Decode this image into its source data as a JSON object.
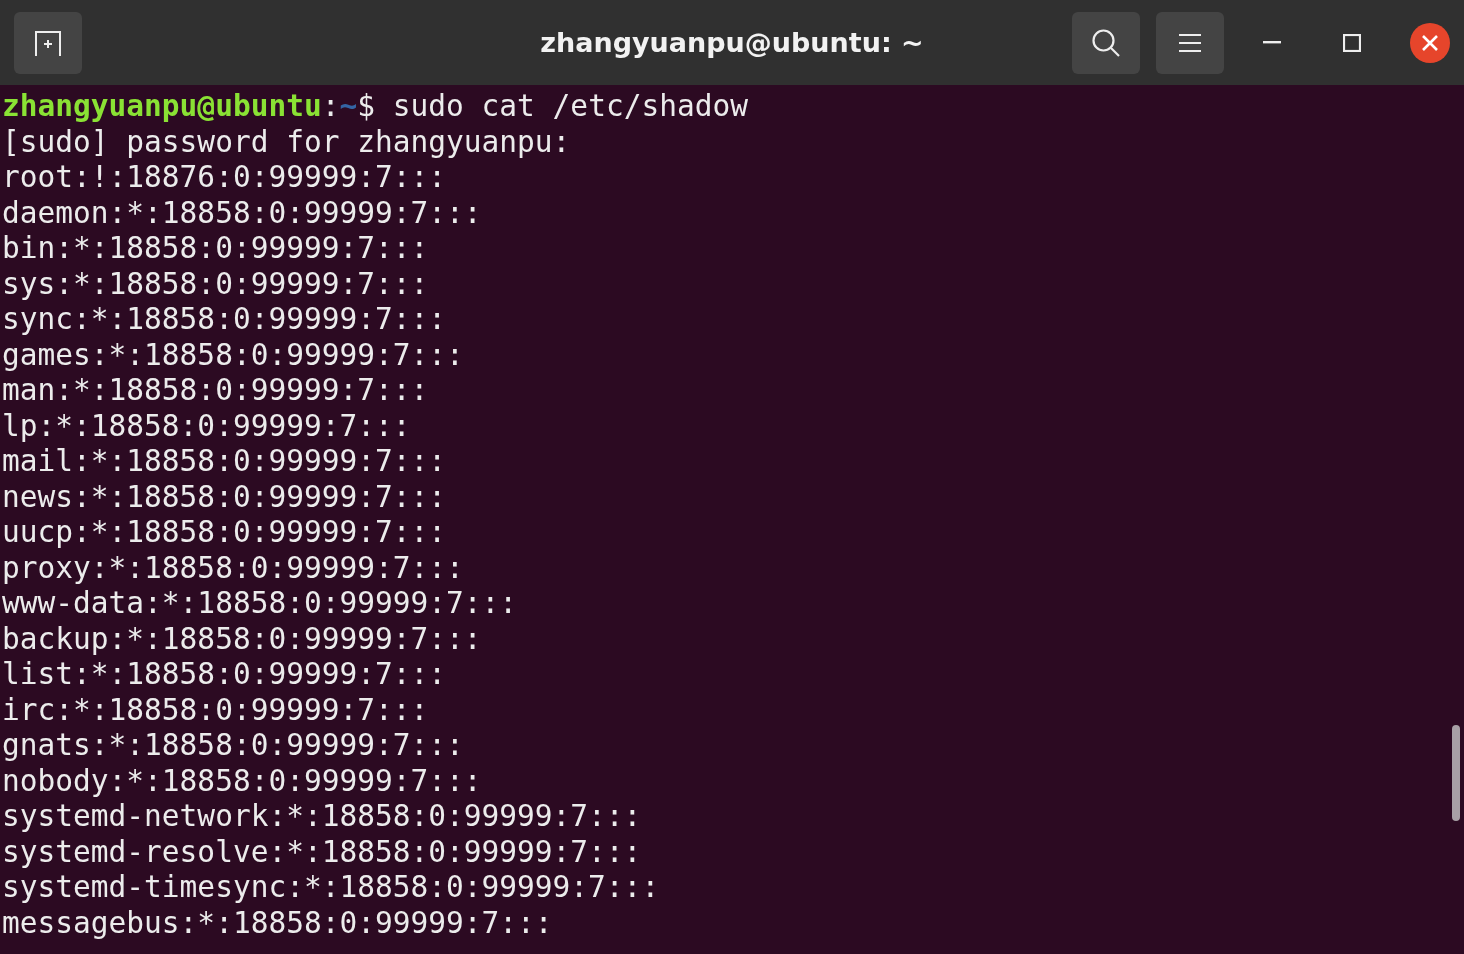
{
  "window": {
    "title": "zhangyuanpu@ubuntu: ~"
  },
  "terminal": {
    "prompt": {
      "user_host": "zhangyuanpu@ubuntu",
      "separator": ":",
      "path": "~",
      "symbol": "$",
      "command": " sudo cat /etc/shadow"
    },
    "output": [
      "[sudo] password for zhangyuanpu:",
      "root:!:18876:0:99999:7:::",
      "daemon:*:18858:0:99999:7:::",
      "bin:*:18858:0:99999:7:::",
      "sys:*:18858:0:99999:7:::",
      "sync:*:18858:0:99999:7:::",
      "games:*:18858:0:99999:7:::",
      "man:*:18858:0:99999:7:::",
      "lp:*:18858:0:99999:7:::",
      "mail:*:18858:0:99999:7:::",
      "news:*:18858:0:99999:7:::",
      "uucp:*:18858:0:99999:7:::",
      "proxy:*:18858:0:99999:7:::",
      "www-data:*:18858:0:99999:7:::",
      "backup:*:18858:0:99999:7:::",
      "list:*:18858:0:99999:7:::",
      "irc:*:18858:0:99999:7:::",
      "gnats:*:18858:0:99999:7:::",
      "nobody:*:18858:0:99999:7:::",
      "systemd-network:*:18858:0:99999:7:::",
      "systemd-resolve:*:18858:0:99999:7:::",
      "systemd-timesync:*:18858:0:99999:7:::",
      "messagebus:*:18858:0:99999:7:::"
    ]
  }
}
